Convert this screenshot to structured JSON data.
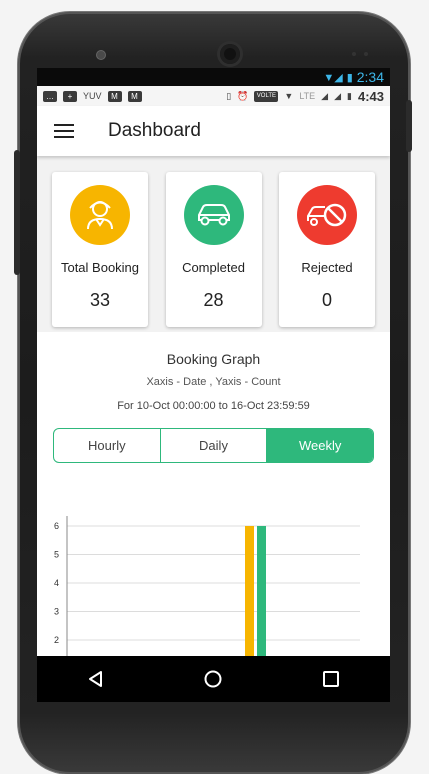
{
  "status": {
    "outer_time": "2:34",
    "inner_time": "4:43",
    "carrier": "YUV",
    "volte": "VOLTE",
    "lte": "LTE"
  },
  "appbar": {
    "title": "Dashboard"
  },
  "cards": [
    {
      "label": "Total Booking",
      "count": "33",
      "color": "#f7b500",
      "icon": "driver-icon"
    },
    {
      "label": "Completed",
      "count": "28",
      "color": "#2eb87c",
      "icon": "car-icon"
    },
    {
      "label": "Rejected",
      "count": "0",
      "color": "#ee3b2f",
      "icon": "car-blocked-icon"
    }
  ],
  "graph": {
    "title": "Booking Graph",
    "subtitle": "Xaxis - Date , Yaxis - Count",
    "range": "For 10-Oct 00:00:00 to 16-Oct 23:59:59",
    "tabs": [
      {
        "label": "Hourly",
        "active": false
      },
      {
        "label": "Daily",
        "active": false
      },
      {
        "label": "Weekly",
        "active": true
      }
    ]
  },
  "chart_data": {
    "type": "bar",
    "y_ticks": [
      2,
      3,
      4,
      5,
      6
    ],
    "ylim": [
      2,
      6
    ],
    "series": [
      {
        "color": "#f7b500",
        "values": [
          6
        ]
      },
      {
        "color": "#2eb87c",
        "values": [
          6
        ]
      }
    ],
    "grid": true
  },
  "colors": {
    "accent": "#2eb87c",
    "warning": "#f7b500",
    "danger": "#ee3b2f"
  }
}
